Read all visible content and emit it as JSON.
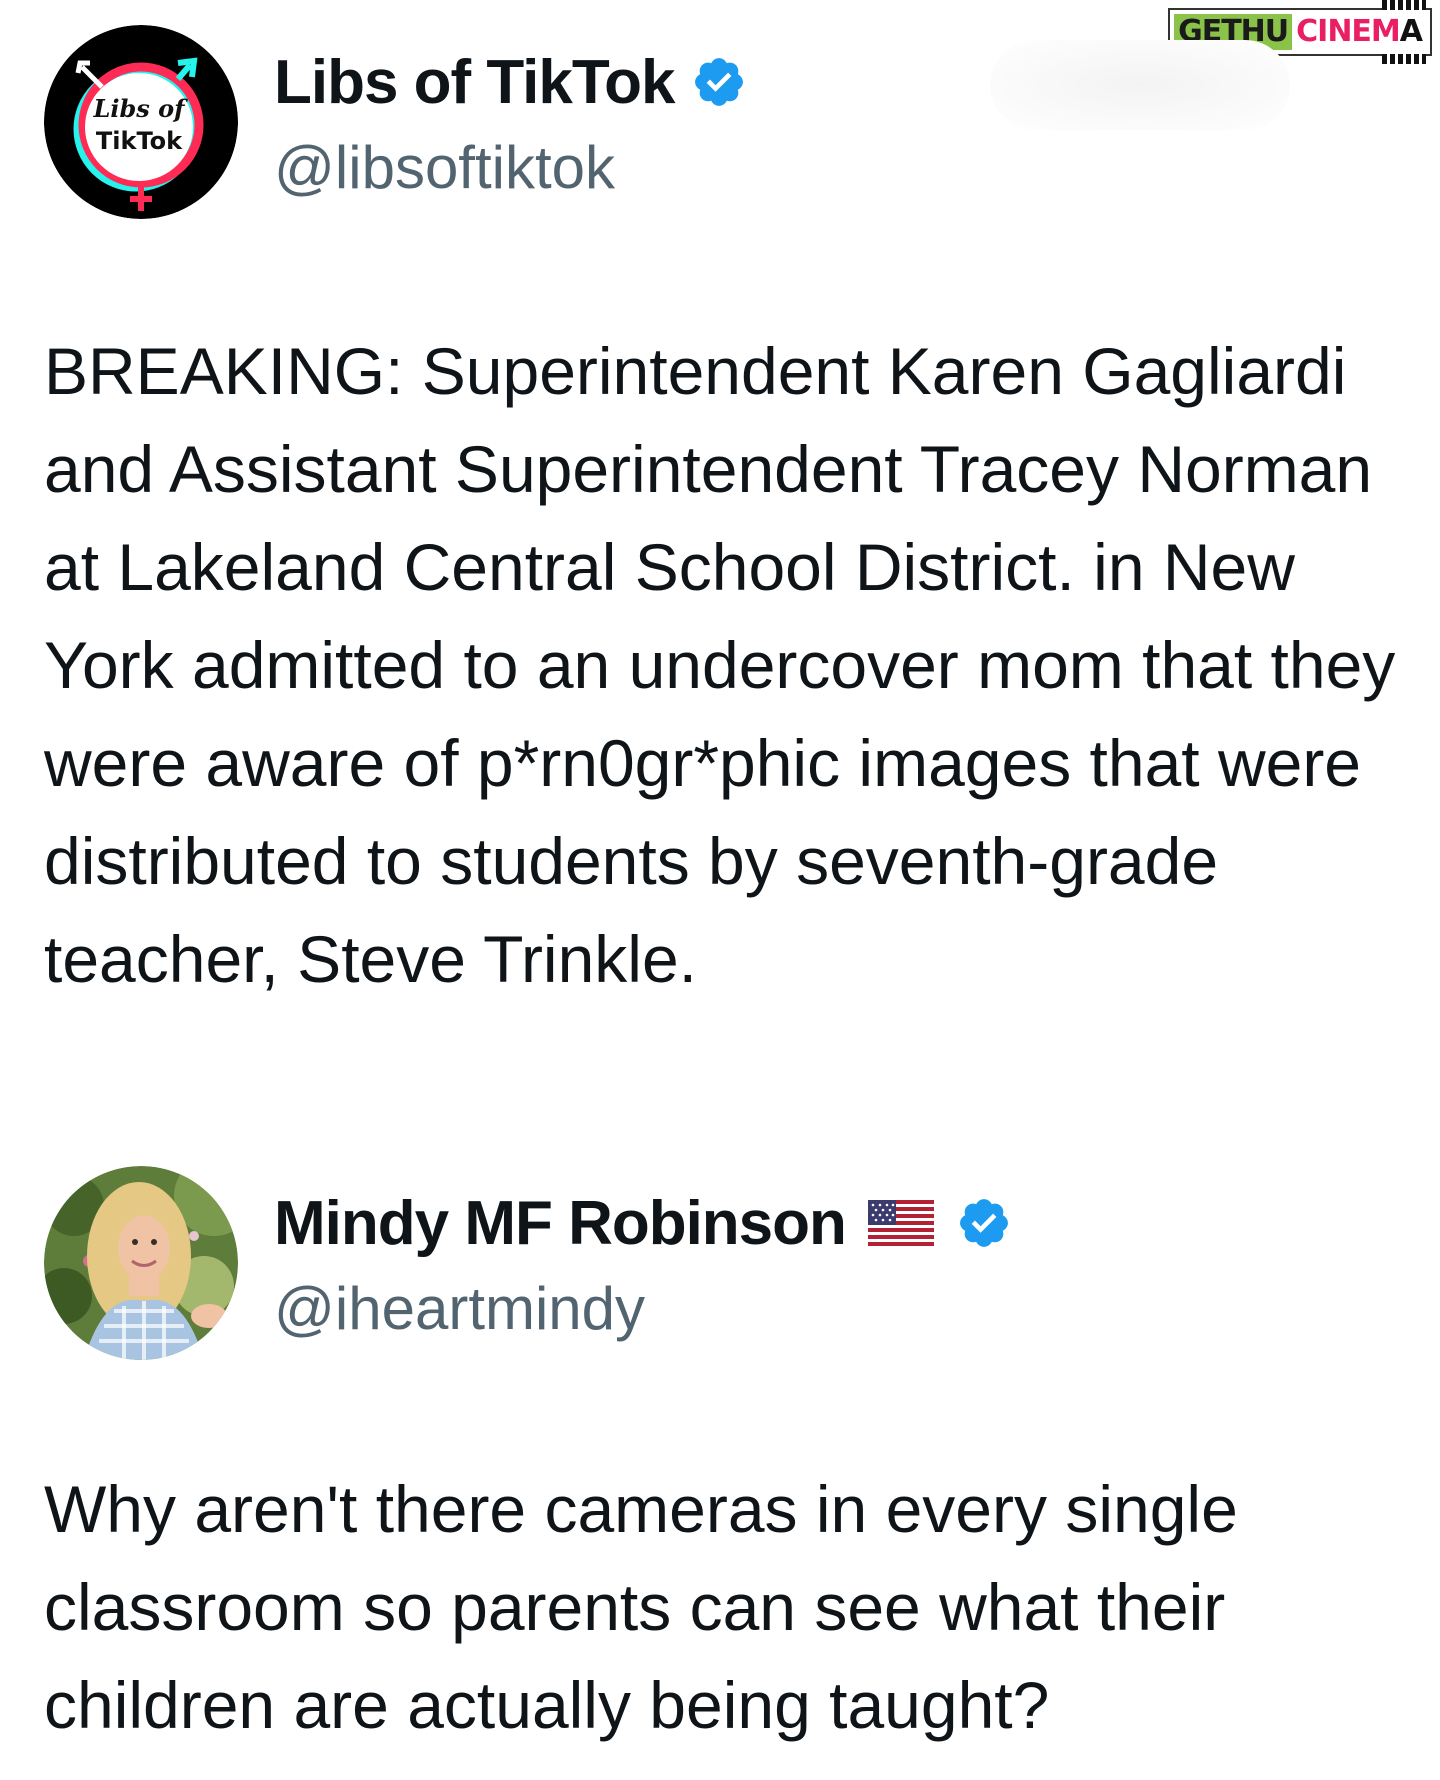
{
  "watermark": {
    "left": "GETHU",
    "right": "CINEM",
    "right_last": "A"
  },
  "tweets": [
    {
      "avatar_text_line1": "Libs of",
      "avatar_text_line2": "TikTok",
      "display_name": "Libs of TikTok",
      "handle": "@libsoftiktok",
      "verified": true,
      "text": "BREAKING: Superintendent Karen Gagliardi and Assistant Superintendent Tracey Norman at Lakeland Central School District. in New York admitted to an undercover mom that they were aware of p*rn0gr*phic images that were distributed to students by seventh-grade teacher, Steve Trinkle."
    },
    {
      "display_name": "Mindy MF Robinson",
      "handle": "@iheartmindy",
      "verified": true,
      "flag_emoji": "🇺🇸",
      "text": "Why aren't there cameras in every single classroom so parents can see what their children are actually being taught?"
    }
  ],
  "colors": {
    "verified_badge": "#1d9bf0",
    "handle": "#536471",
    "text": "#0f1419"
  }
}
